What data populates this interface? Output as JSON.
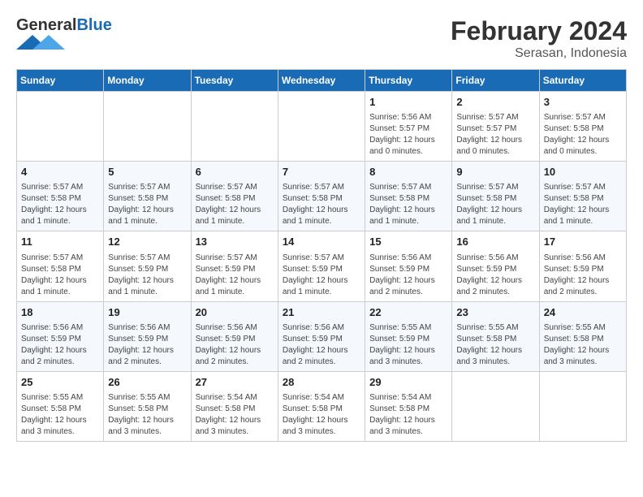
{
  "logo": {
    "text_general": "General",
    "text_blue": "Blue"
  },
  "title": "February 2024",
  "subtitle": "Serasan, Indonesia",
  "days_of_week": [
    "Sunday",
    "Monday",
    "Tuesday",
    "Wednesday",
    "Thursday",
    "Friday",
    "Saturday"
  ],
  "weeks": [
    [
      {
        "day": "",
        "info": ""
      },
      {
        "day": "",
        "info": ""
      },
      {
        "day": "",
        "info": ""
      },
      {
        "day": "",
        "info": ""
      },
      {
        "day": "1",
        "info": "Sunrise: 5:56 AM\nSunset: 5:57 PM\nDaylight: 12 hours and 0 minutes."
      },
      {
        "day": "2",
        "info": "Sunrise: 5:57 AM\nSunset: 5:57 PM\nDaylight: 12 hours and 0 minutes."
      },
      {
        "day": "3",
        "info": "Sunrise: 5:57 AM\nSunset: 5:58 PM\nDaylight: 12 hours and 0 minutes."
      }
    ],
    [
      {
        "day": "4",
        "info": "Sunrise: 5:57 AM\nSunset: 5:58 PM\nDaylight: 12 hours and 1 minute."
      },
      {
        "day": "5",
        "info": "Sunrise: 5:57 AM\nSunset: 5:58 PM\nDaylight: 12 hours and 1 minute."
      },
      {
        "day": "6",
        "info": "Sunrise: 5:57 AM\nSunset: 5:58 PM\nDaylight: 12 hours and 1 minute."
      },
      {
        "day": "7",
        "info": "Sunrise: 5:57 AM\nSunset: 5:58 PM\nDaylight: 12 hours and 1 minute."
      },
      {
        "day": "8",
        "info": "Sunrise: 5:57 AM\nSunset: 5:58 PM\nDaylight: 12 hours and 1 minute."
      },
      {
        "day": "9",
        "info": "Sunrise: 5:57 AM\nSunset: 5:58 PM\nDaylight: 12 hours and 1 minute."
      },
      {
        "day": "10",
        "info": "Sunrise: 5:57 AM\nSunset: 5:58 PM\nDaylight: 12 hours and 1 minute."
      }
    ],
    [
      {
        "day": "11",
        "info": "Sunrise: 5:57 AM\nSunset: 5:58 PM\nDaylight: 12 hours and 1 minute."
      },
      {
        "day": "12",
        "info": "Sunrise: 5:57 AM\nSunset: 5:59 PM\nDaylight: 12 hours and 1 minute."
      },
      {
        "day": "13",
        "info": "Sunrise: 5:57 AM\nSunset: 5:59 PM\nDaylight: 12 hours and 1 minute."
      },
      {
        "day": "14",
        "info": "Sunrise: 5:57 AM\nSunset: 5:59 PM\nDaylight: 12 hours and 1 minute."
      },
      {
        "day": "15",
        "info": "Sunrise: 5:56 AM\nSunset: 5:59 PM\nDaylight: 12 hours and 2 minutes."
      },
      {
        "day": "16",
        "info": "Sunrise: 5:56 AM\nSunset: 5:59 PM\nDaylight: 12 hours and 2 minutes."
      },
      {
        "day": "17",
        "info": "Sunrise: 5:56 AM\nSunset: 5:59 PM\nDaylight: 12 hours and 2 minutes."
      }
    ],
    [
      {
        "day": "18",
        "info": "Sunrise: 5:56 AM\nSunset: 5:59 PM\nDaylight: 12 hours and 2 minutes."
      },
      {
        "day": "19",
        "info": "Sunrise: 5:56 AM\nSunset: 5:59 PM\nDaylight: 12 hours and 2 minutes."
      },
      {
        "day": "20",
        "info": "Sunrise: 5:56 AM\nSunset: 5:59 PM\nDaylight: 12 hours and 2 minutes."
      },
      {
        "day": "21",
        "info": "Sunrise: 5:56 AM\nSunset: 5:59 PM\nDaylight: 12 hours and 2 minutes."
      },
      {
        "day": "22",
        "info": "Sunrise: 5:55 AM\nSunset: 5:59 PM\nDaylight: 12 hours and 3 minutes."
      },
      {
        "day": "23",
        "info": "Sunrise: 5:55 AM\nSunset: 5:58 PM\nDaylight: 12 hours and 3 minutes."
      },
      {
        "day": "24",
        "info": "Sunrise: 5:55 AM\nSunset: 5:58 PM\nDaylight: 12 hours and 3 minutes."
      }
    ],
    [
      {
        "day": "25",
        "info": "Sunrise: 5:55 AM\nSunset: 5:58 PM\nDaylight: 12 hours and 3 minutes."
      },
      {
        "day": "26",
        "info": "Sunrise: 5:55 AM\nSunset: 5:58 PM\nDaylight: 12 hours and 3 minutes."
      },
      {
        "day": "27",
        "info": "Sunrise: 5:54 AM\nSunset: 5:58 PM\nDaylight: 12 hours and 3 minutes."
      },
      {
        "day": "28",
        "info": "Sunrise: 5:54 AM\nSunset: 5:58 PM\nDaylight: 12 hours and 3 minutes."
      },
      {
        "day": "29",
        "info": "Sunrise: 5:54 AM\nSunset: 5:58 PM\nDaylight: 12 hours and 3 minutes."
      },
      {
        "day": "",
        "info": ""
      },
      {
        "day": "",
        "info": ""
      }
    ]
  ]
}
